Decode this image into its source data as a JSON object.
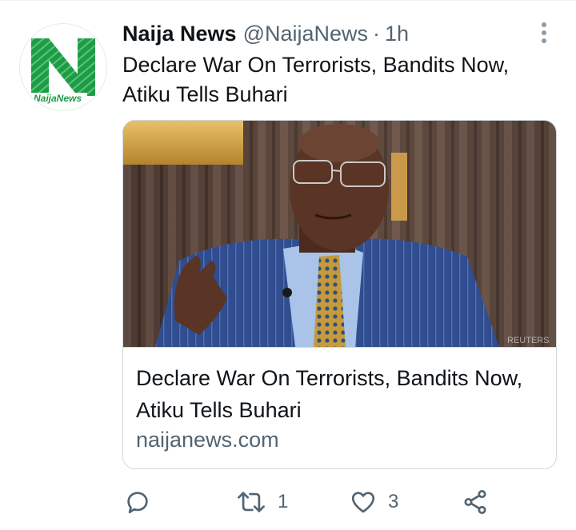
{
  "tweet": {
    "author": {
      "display_name": "Naija News",
      "handle": "@NaijaNews",
      "time": "1h",
      "avatar_text": "NaijaNews"
    },
    "text": "Declare War On Terrorists, Bandits Now, Atiku Tells Buhari",
    "card": {
      "title": "Declare War On Terrorists, Bandits Now, Atiku Tells Buhari",
      "domain": "naijanews.com",
      "image_watermark": "REUTERS"
    },
    "actions": {
      "reply_count": "",
      "retweet_count": "1",
      "like_count": "3"
    }
  },
  "colors": {
    "secondary_text": "#536471",
    "primary_text": "#0f1419",
    "border": "#cfd9de",
    "logo_green": "#1e9b46"
  },
  "icons": [
    "more-vertical-icon",
    "reply-icon",
    "retweet-icon",
    "like-icon",
    "share-icon"
  ]
}
